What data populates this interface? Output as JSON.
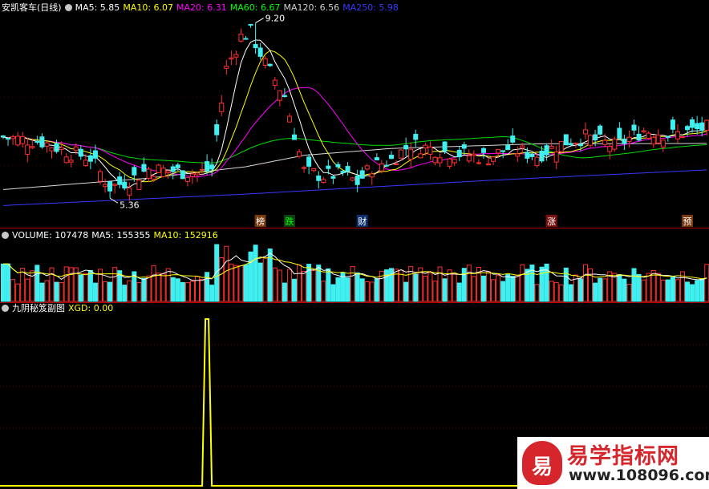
{
  "main_header": {
    "stock": "安凯客车(日线)",
    "items": [
      {
        "label": "MA5: 5.85",
        "color": "#ffffff"
      },
      {
        "label": "MA10: 6.07",
        "color": "#ffff00"
      },
      {
        "label": "MA20: 6.31",
        "color": "#ff00ff"
      },
      {
        "label": "MA60: 6.67",
        "color": "#00ff00"
      },
      {
        "label": "MA120: 6.56",
        "color": "#d0d0d0"
      },
      {
        "label": "MA250: 5.98",
        "color": "#3838ff"
      }
    ]
  },
  "volume_header": {
    "items": [
      {
        "label": "VOLUME: 107478",
        "color": "#ffffff"
      },
      {
        "label": "MA5: 155355",
        "color": "#ffffff"
      },
      {
        "label": "MA10: 152916",
        "color": "#ffff00"
      }
    ]
  },
  "sub_header": {
    "items": [
      {
        "label": "九阴秘笈副图",
        "color": "#ffffff"
      },
      {
        "label": "XGD: 0.00",
        "color": "#ffff00"
      }
    ]
  },
  "watermark": {
    "icon_char": "易",
    "name": "易学指标网",
    "url": "www.108096.com"
  },
  "chart_data": {
    "type": "candlestick",
    "price_range": [
      4.75,
      9.35
    ],
    "markers": [
      {
        "label": "9.20",
        "index": 52
      },
      {
        "label": "5.36",
        "index": 22
      }
    ],
    "event_tags": [
      {
        "label": "榜",
        "index": 53,
        "color": "#ffffff",
        "bg": "#7a3a10"
      },
      {
        "label": "跌",
        "index": 59,
        "color": "#00ff00",
        "bg": "#0f4010"
      },
      {
        "label": "财",
        "index": 74,
        "color": "#ffffff",
        "bg": "#103070"
      },
      {
        "label": "涨",
        "index": 113,
        "color": "#ffffff",
        "bg": "#7a1010"
      },
      {
        "label": "预",
        "index": 141,
        "color": "#ffffff",
        "bg": "#7a3a10"
      }
    ],
    "ma_lines": [
      {
        "name": "MA120",
        "color": "#d8d8d8",
        "points": [
          [
            0,
            5.55
          ],
          [
            30,
            5.8
          ],
          [
            50,
            6.05
          ],
          [
            62,
            6.3
          ],
          [
            80,
            6.45
          ],
          [
            110,
            6.55
          ],
          [
            145,
            6.56
          ]
        ]
      },
      {
        "name": "MA250",
        "color": "#3838ff",
        "points": [
          [
            0,
            5.2
          ],
          [
            50,
            5.45
          ],
          [
            100,
            5.75
          ],
          [
            145,
            5.98
          ]
        ]
      }
    ],
    "xgd_signal": {
      "index": 42,
      "peak": 1.0
    },
    "volume_max": 450000
  }
}
